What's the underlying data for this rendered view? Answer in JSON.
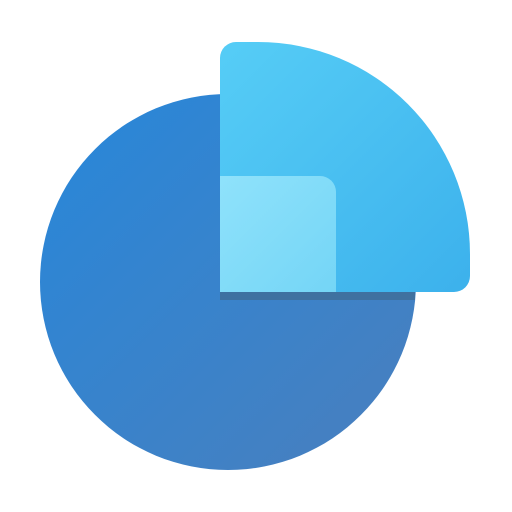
{
  "icon": {
    "name": "pie-chart-app-icon",
    "colors": {
      "background": "#ffffff",
      "main_disc_light": "#2787da",
      "main_disc_dark": "#4a7fbd",
      "wedge_light": "#56cdf6",
      "wedge_dark": "#3cb1ec",
      "inner_square_light": "#8fe2fb",
      "inner_square_dark": "#74d5f6",
      "shadow": "#3f6f99"
    }
  }
}
